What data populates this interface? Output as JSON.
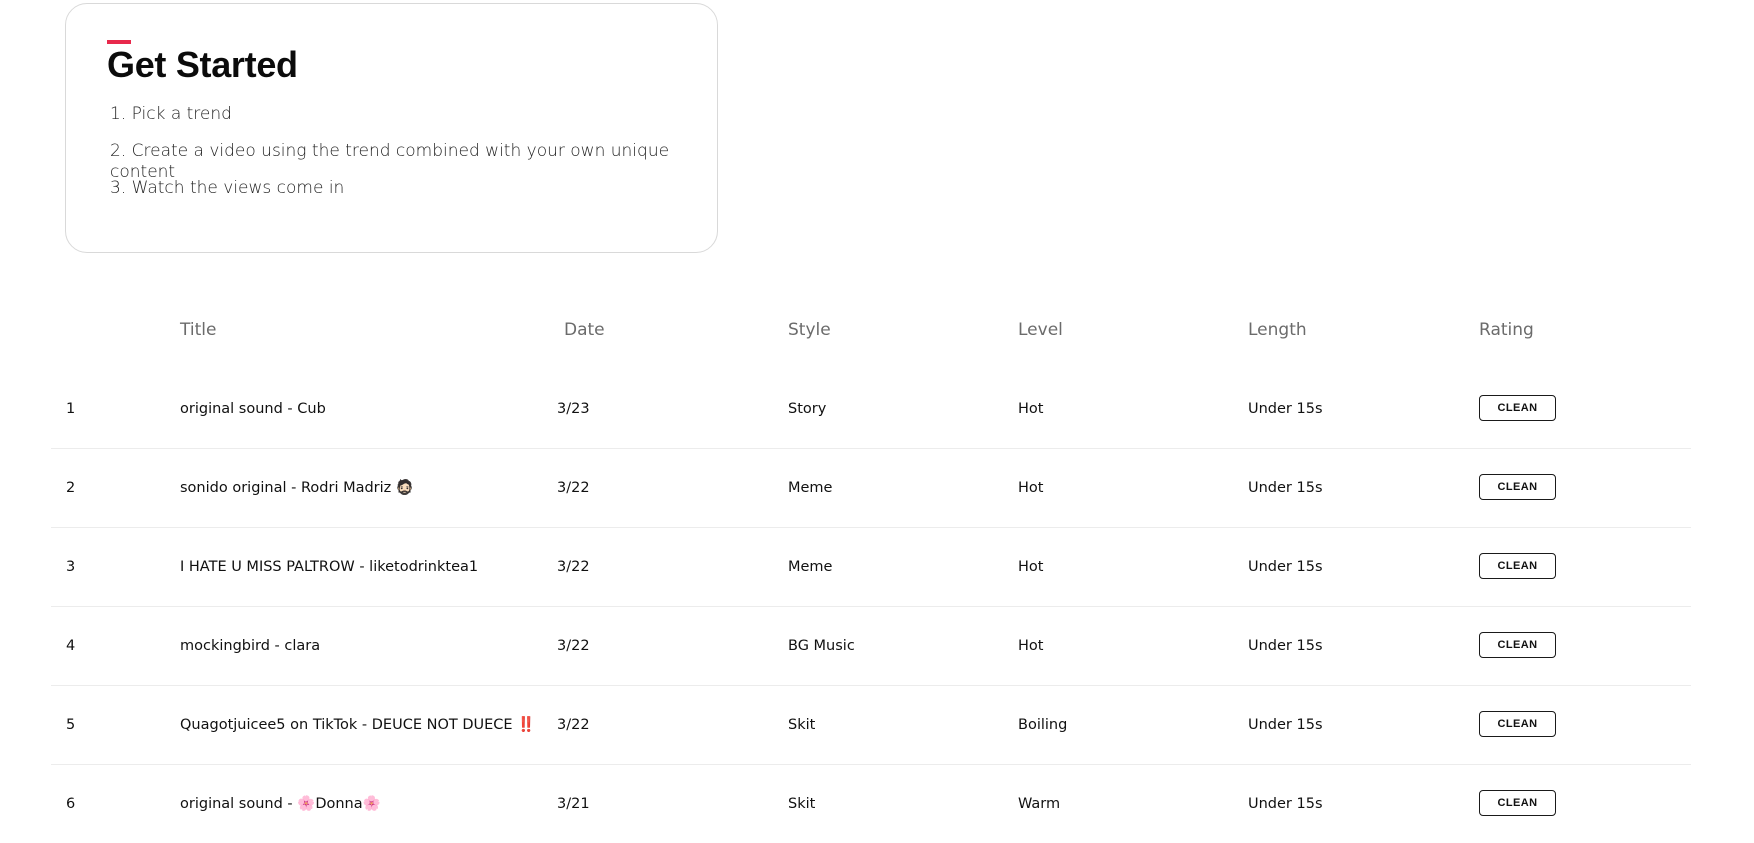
{
  "get_started": {
    "title": "Get Started",
    "steps": [
      "1. Pick a trend",
      "2. Create a video using the trend combined with your own unique content",
      "3. Watch the views come in"
    ]
  },
  "table": {
    "headers": {
      "title": "Title",
      "date": "Date",
      "style": "Style",
      "level": "Level",
      "length": "Length",
      "rating": "Rating"
    },
    "rows": [
      {
        "num": "1",
        "title": "original sound - Cub",
        "date": "3/23",
        "style": "Story",
        "level": "Hot",
        "length": "Under 15s",
        "rating": "CLEAN"
      },
      {
        "num": "2",
        "title": "sonido original - Rodri Madriz 🧔🏻",
        "date": "3/22",
        "style": "Meme",
        "level": "Hot",
        "length": "Under 15s",
        "rating": "CLEAN"
      },
      {
        "num": "3",
        "title": "I HATE U MISS PALTROW - liketodrinktea1",
        "date": "3/22",
        "style": "Meme",
        "level": "Hot",
        "length": "Under 15s",
        "rating": "CLEAN"
      },
      {
        "num": "4",
        "title": "mockingbird - clara",
        "date": "3/22",
        "style": "BG Music",
        "level": "Hot",
        "length": "Under 15s",
        "rating": "CLEAN"
      },
      {
        "num": "5",
        "title": "Quagotjuicee5 on TikTok - DEUCE NOT DUECE ‼️",
        "date": "3/22",
        "style": "Skit",
        "level": "Boiling",
        "length": "Under 15s",
        "rating": "CLEAN"
      },
      {
        "num": "6",
        "title": "original sound - 🌸Donna🌸",
        "date": "3/21",
        "style": "Skit",
        "level": "Warm",
        "length": "Under 15s",
        "rating": "CLEAN"
      }
    ]
  },
  "colors": {
    "accent": "#e8294c",
    "border": "#d9d9d9",
    "header_text": "#6b6b6b",
    "row_divider": "#ececec"
  }
}
